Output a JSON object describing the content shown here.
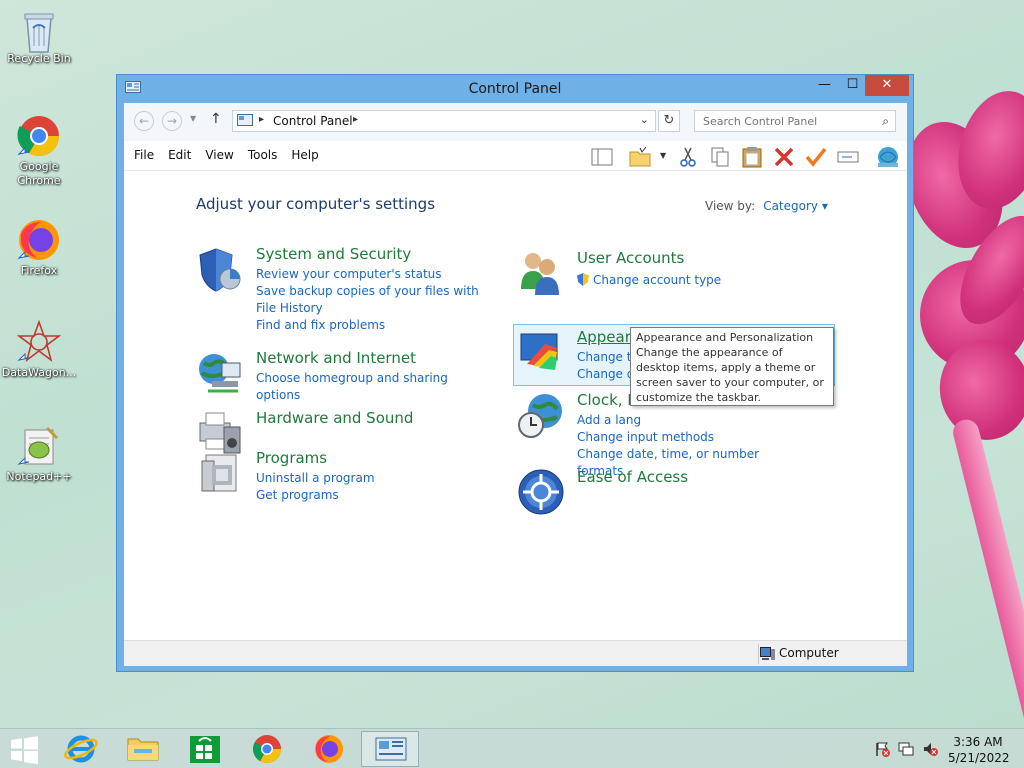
{
  "desktop": {
    "icons": [
      {
        "label": "Recycle Bin"
      },
      {
        "label": "Google Chrome"
      },
      {
        "label": "Firefox"
      },
      {
        "label": "DataWagon..."
      },
      {
        "label": "Notepad++"
      }
    ]
  },
  "window": {
    "title": "Control Panel",
    "buttons": {
      "minimize": "—",
      "maximize": "☐",
      "close": "✕"
    },
    "address": {
      "crumb": "Control Panel",
      "sep": "▸"
    },
    "search": {
      "placeholder": "Search Control Panel"
    },
    "menu": [
      "File",
      "Edit",
      "View",
      "Tools",
      "Help"
    ],
    "heading": "Adjust your computer's settings",
    "view_by": {
      "label": "View by:",
      "value": "Category ▾"
    },
    "categories_left": [
      {
        "title": "System and Security",
        "links": [
          "Review your computer's status",
          "Save backup copies of your files with File History",
          "Find and fix problems"
        ]
      },
      {
        "title": "Network and Internet",
        "links": [
          "Choose homegroup and sharing options"
        ]
      },
      {
        "title": "Hardware and Sound",
        "links": []
      },
      {
        "title": "Programs",
        "links": [
          "Uninstall a program",
          "Get programs"
        ]
      }
    ],
    "categories_right": [
      {
        "title": "User Accounts",
        "links": [
          "Change account type"
        ]
      },
      {
        "title": "Appearance and Personalization",
        "links": [
          "Change the theme",
          "Change de"
        ]
      },
      {
        "title": "Clock, L",
        "links": [
          "Add a lang",
          "Change input methods",
          "Change date, time, or number formats"
        ]
      },
      {
        "title": "Ease of Access",
        "links": []
      }
    ],
    "tooltip": {
      "title": "Appearance and Personalization",
      "body": "Change the appearance of desktop items, apply a theme or screen saver to your computer, or customize the taskbar."
    },
    "status": {
      "computer": "Computer"
    }
  },
  "taskbar": {
    "time": "3:36 AM",
    "date": "5/21/2022"
  }
}
